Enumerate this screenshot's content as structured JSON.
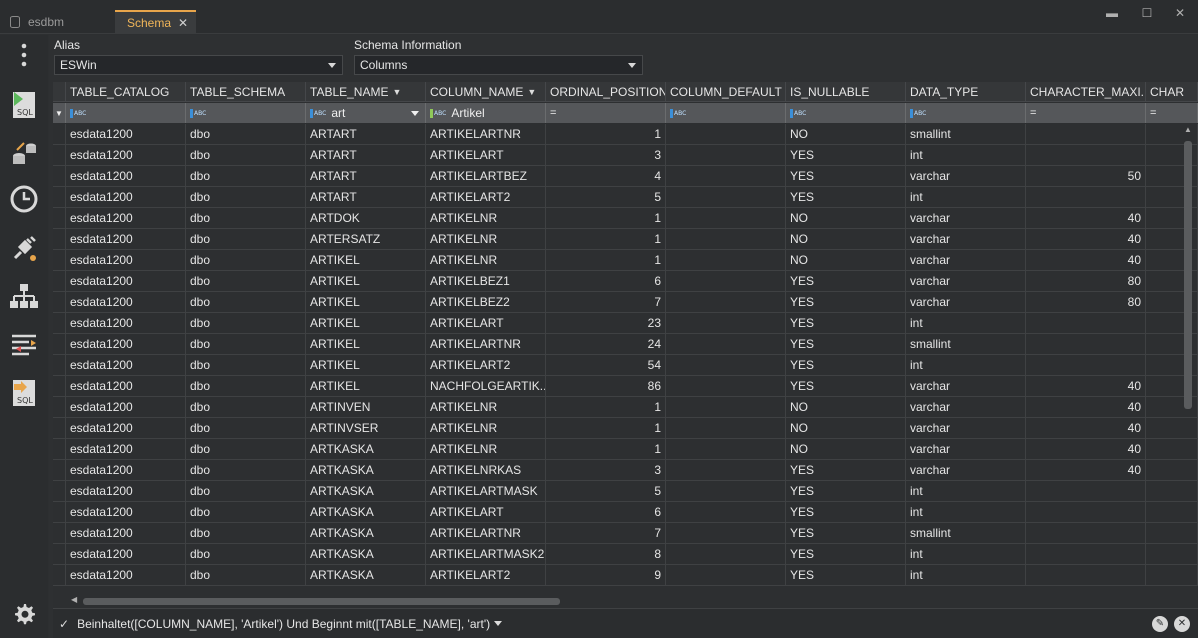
{
  "window": {
    "tabs": [
      {
        "label": "esdbm",
        "active": false
      },
      {
        "label": "Schema",
        "active": true
      }
    ],
    "controls": {
      "minimize": "▬",
      "maximize": "☐",
      "close": "✕"
    }
  },
  "sidebar": {
    "icons": [
      "more-menu-icon",
      "sql-editor-icon",
      "data-transfer-icon",
      "history-icon",
      "connection-plugin-icon",
      "schema-tree-icon",
      "compare-icon",
      "sql-export-icon",
      "settings-icon"
    ]
  },
  "alias": {
    "label": "Alias",
    "value": "ESWin"
  },
  "schema_info": {
    "label": "Schema Information",
    "value": "Columns"
  },
  "grid": {
    "columns": [
      {
        "name": "TABLE_CATALOG",
        "filtered": false
      },
      {
        "name": "TABLE_SCHEMA",
        "filtered": false
      },
      {
        "name": "TABLE_NAME",
        "filtered": true
      },
      {
        "name": "COLUMN_NAME",
        "filtered": true
      },
      {
        "name": "ORDINAL_POSITION",
        "filtered": false
      },
      {
        "name": "COLUMN_DEFAULT",
        "filtered": false
      },
      {
        "name": "IS_NULLABLE",
        "filtered": false
      },
      {
        "name": "DATA_TYPE",
        "filtered": false
      },
      {
        "name": "CHARACTER_MAXI...",
        "filtered": false
      },
      {
        "name": "CHAR",
        "filtered": false
      }
    ],
    "filters": {
      "type_label": "ABC",
      "table_name": "art",
      "column_name": "Artikel",
      "equals": "="
    },
    "rows": [
      [
        "esdata1200",
        "dbo",
        "ARTART",
        "ARTIKELARTNR",
        "1",
        "",
        "NO",
        "smallint",
        ""
      ],
      [
        "esdata1200",
        "dbo",
        "ARTART",
        "ARTIKELART",
        "3",
        "",
        "YES",
        "int",
        ""
      ],
      [
        "esdata1200",
        "dbo",
        "ARTART",
        "ARTIKELARTBEZ",
        "4",
        "",
        "YES",
        "varchar",
        "50"
      ],
      [
        "esdata1200",
        "dbo",
        "ARTART",
        "ARTIKELART2",
        "5",
        "",
        "YES",
        "int",
        ""
      ],
      [
        "esdata1200",
        "dbo",
        "ARTDOK",
        "ARTIKELNR",
        "1",
        "",
        "NO",
        "varchar",
        "40"
      ],
      [
        "esdata1200",
        "dbo",
        "ARTERSATZ",
        "ARTIKELNR",
        "1",
        "",
        "NO",
        "varchar",
        "40"
      ],
      [
        "esdata1200",
        "dbo",
        "ARTIKEL",
        "ARTIKELNR",
        "1",
        "",
        "NO",
        "varchar",
        "40"
      ],
      [
        "esdata1200",
        "dbo",
        "ARTIKEL",
        "ARTIKELBEZ1",
        "6",
        "",
        "YES",
        "varchar",
        "80"
      ],
      [
        "esdata1200",
        "dbo",
        "ARTIKEL",
        "ARTIKELBEZ2",
        "7",
        "",
        "YES",
        "varchar",
        "80"
      ],
      [
        "esdata1200",
        "dbo",
        "ARTIKEL",
        "ARTIKELART",
        "23",
        "",
        "YES",
        "int",
        ""
      ],
      [
        "esdata1200",
        "dbo",
        "ARTIKEL",
        "ARTIKELARTNR",
        "24",
        "",
        "YES",
        "smallint",
        ""
      ],
      [
        "esdata1200",
        "dbo",
        "ARTIKEL",
        "ARTIKELART2",
        "54",
        "",
        "YES",
        "int",
        ""
      ],
      [
        "esdata1200",
        "dbo",
        "ARTIKEL",
        "NACHFOLGEARTIK...",
        "86",
        "",
        "YES",
        "varchar",
        "40"
      ],
      [
        "esdata1200",
        "dbo",
        "ARTINVEN",
        "ARTIKELNR",
        "1",
        "",
        "NO",
        "varchar",
        "40"
      ],
      [
        "esdata1200",
        "dbo",
        "ARTINVSER",
        "ARTIKELNR",
        "1",
        "",
        "NO",
        "varchar",
        "40"
      ],
      [
        "esdata1200",
        "dbo",
        "ARTKASKA",
        "ARTIKELNR",
        "1",
        "",
        "NO",
        "varchar",
        "40"
      ],
      [
        "esdata1200",
        "dbo",
        "ARTKASKA",
        "ARTIKELNRKAS",
        "3",
        "",
        "YES",
        "varchar",
        "40"
      ],
      [
        "esdata1200",
        "dbo",
        "ARTKASKA",
        "ARTIKELARTMASK",
        "5",
        "",
        "YES",
        "int",
        ""
      ],
      [
        "esdata1200",
        "dbo",
        "ARTKASKA",
        "ARTIKELART",
        "6",
        "",
        "YES",
        "int",
        ""
      ],
      [
        "esdata1200",
        "dbo",
        "ARTKASKA",
        "ARTIKELARTNR",
        "7",
        "",
        "YES",
        "smallint",
        ""
      ],
      [
        "esdata1200",
        "dbo",
        "ARTKASKA",
        "ARTIKELARTMASK2",
        "8",
        "",
        "YES",
        "int",
        ""
      ],
      [
        "esdata1200",
        "dbo",
        "ARTKASKA",
        "ARTIKELART2",
        "9",
        "",
        "YES",
        "int",
        ""
      ]
    ]
  },
  "filter_bar": {
    "enabled_mark": "✓",
    "expression": "Beinhaltet([COLUMN_NAME], 'Artikel') Und Beginnt mit([TABLE_NAME], 'art')",
    "edit_icon": "✎",
    "clear_icon": "✕"
  },
  "colors": {
    "accent": "#e8a54b",
    "background": "#2d2f31",
    "filter_row": "#55575a"
  }
}
